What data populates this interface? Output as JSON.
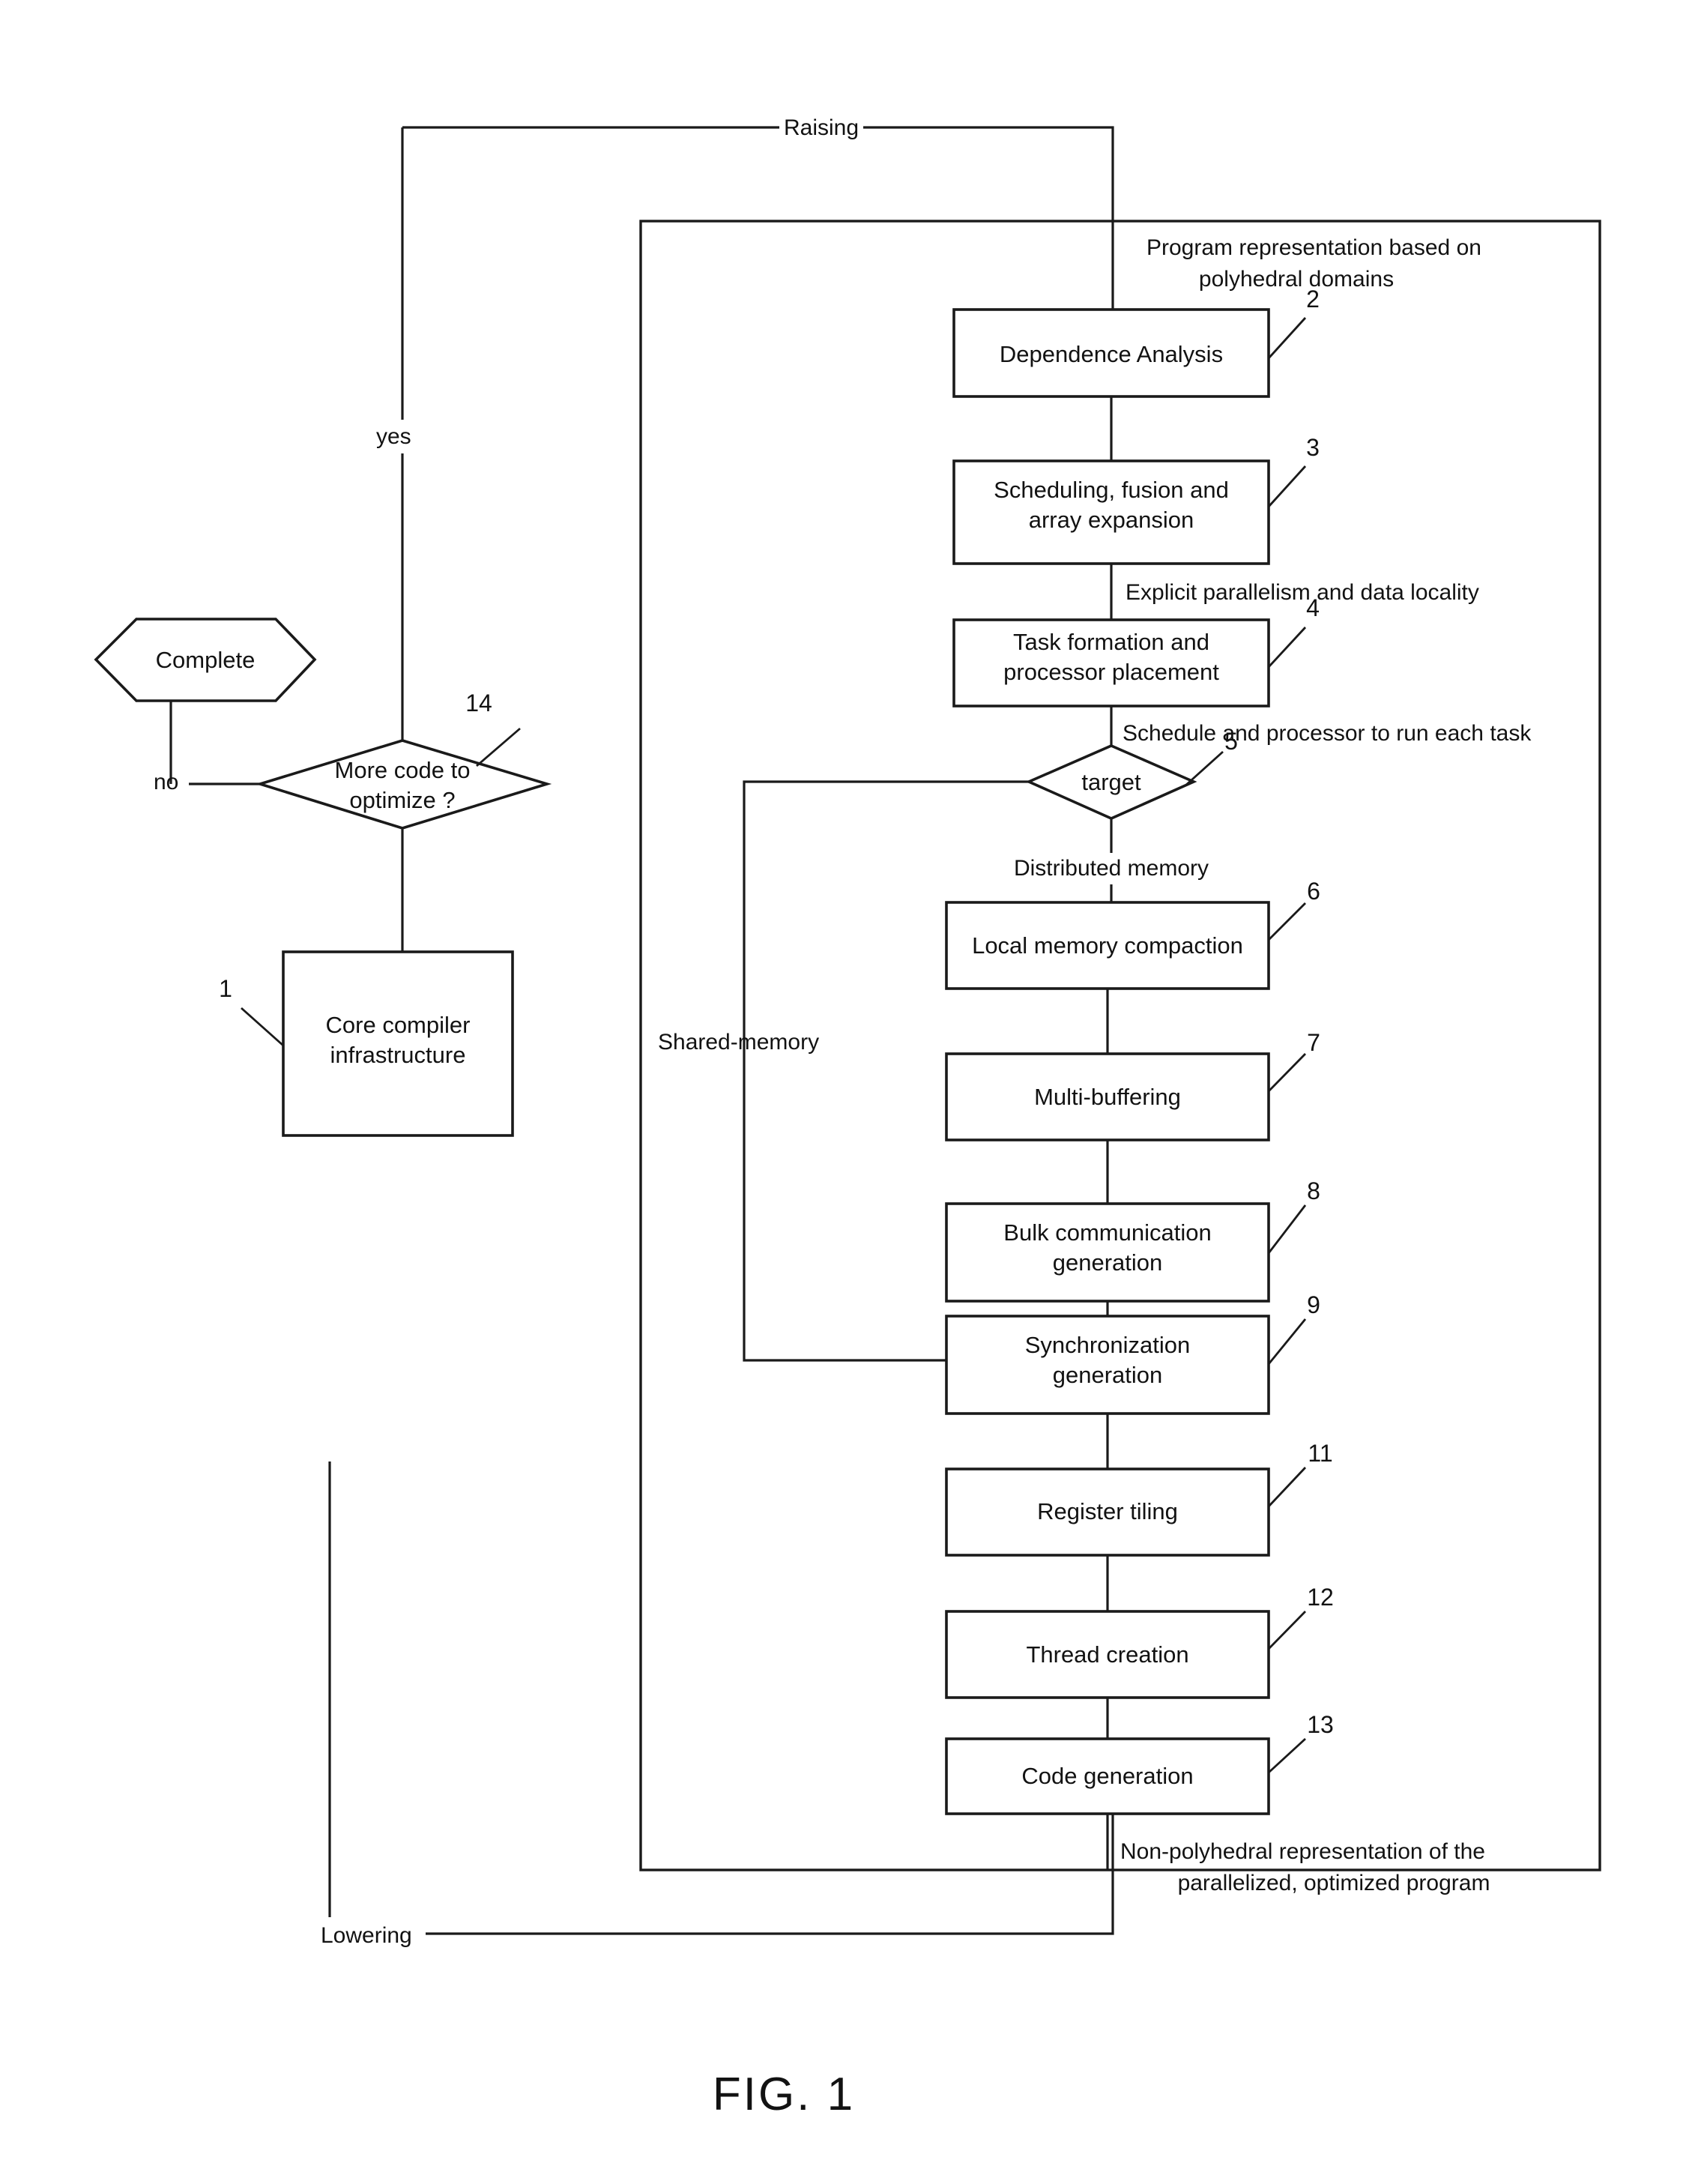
{
  "figure": {
    "caption": "FIG. 1",
    "type": "patent-flowchart",
    "line_color": "#1a1a1a",
    "background": "#ffffff"
  },
  "nodes": [
    {
      "id": "complete",
      "shape": "hexagon",
      "label": "Complete",
      "ref": ""
    },
    {
      "id": "more-code",
      "shape": "diamond",
      "label_line1": "More code to",
      "label_line2": "optimize ?",
      "ref": "14"
    },
    {
      "id": "core-compiler",
      "shape": "rect",
      "label_line1": "Core compiler",
      "label_line2": "infrastructure",
      "ref": "1"
    },
    {
      "id": "dependence-analysis",
      "shape": "rect",
      "label": "Dependence Analysis",
      "ref": "2"
    },
    {
      "id": "scheduling-fusion",
      "shape": "rect",
      "label_line1": "Scheduling, fusion and",
      "label_line2": "array expansion",
      "ref": "3"
    },
    {
      "id": "task-formation",
      "shape": "rect",
      "label_line1": "Task formation and",
      "label_line2": "processor placement",
      "ref": "4"
    },
    {
      "id": "target",
      "shape": "diamond",
      "label": "target",
      "ref": "5"
    },
    {
      "id": "local-memory-compaction",
      "shape": "rect",
      "label": "Local memory compaction",
      "ref": "6"
    },
    {
      "id": "multi-buffering",
      "shape": "rect",
      "label": "Multi-buffering",
      "ref": "7"
    },
    {
      "id": "bulk-communication",
      "shape": "rect",
      "label_line1": "Bulk communication",
      "label_line2": "generation",
      "ref": "8"
    },
    {
      "id": "synchronization",
      "shape": "rect",
      "label_line1": "Synchronization",
      "label_line2": "generation",
      "ref": "9"
    },
    {
      "id": "register-tiling",
      "shape": "rect",
      "label": "Register tiling",
      "ref": "11"
    },
    {
      "id": "thread-creation",
      "shape": "rect",
      "label": "Thread creation",
      "ref": "12"
    },
    {
      "id": "code-generation",
      "shape": "rect",
      "label": "Code generation",
      "ref": "13"
    }
  ],
  "edge_labels": {
    "raising": "Raising",
    "lowering": "Lowering",
    "yes": "yes",
    "no": "no",
    "program_representation_line1": "Program representation based on",
    "program_representation_line2": "polyhedral domains",
    "explicit_parallelism": "Explicit parallelism and data locality",
    "schedule_processor": "Schedule and processor to run each task",
    "distributed_memory": "Distributed memory",
    "shared_memory": "Shared-memory",
    "non_polyhedral_line1": "Non-polyhedral representation of the",
    "non_polyhedral_line2": "parallelized, optimized program"
  },
  "reference_numerals": [
    "1",
    "2",
    "3",
    "4",
    "5",
    "6",
    "7",
    "8",
    "9",
    "11",
    "12",
    "13",
    "14"
  ]
}
